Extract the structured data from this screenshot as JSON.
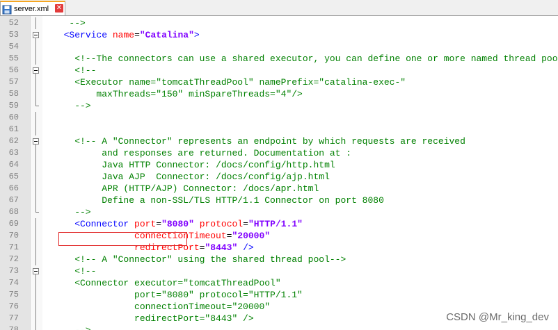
{
  "tab": {
    "label": "server.xml",
    "file_icon": "save-disk-icon",
    "close_icon": "close-icon"
  },
  "lines": [
    {
      "n": "52",
      "fold": "line",
      "segs": [
        {
          "t": "   -->",
          "c": "comment"
        }
      ]
    },
    {
      "n": "53",
      "fold": "open",
      "segs": [
        {
          "t": "  ",
          "c": "plain"
        },
        {
          "t": "<Service",
          "c": "tag"
        },
        {
          "t": " ",
          "c": "plain"
        },
        {
          "t": "name",
          "c": "attr"
        },
        {
          "t": "=",
          "c": "eq"
        },
        {
          "t": "\"Catalina\"",
          "c": "val"
        },
        {
          "t": ">",
          "c": "tag"
        }
      ]
    },
    {
      "n": "54",
      "fold": "line",
      "segs": []
    },
    {
      "n": "55",
      "fold": "line",
      "segs": [
        {
          "t": "    <!--The connectors can use a shared executor, you can define one or more named thread pools",
          "c": "comment"
        }
      ]
    },
    {
      "n": "56",
      "fold": "open",
      "segs": [
        {
          "t": "    <!--",
          "c": "comment"
        }
      ]
    },
    {
      "n": "57",
      "fold": "line",
      "segs": [
        {
          "t": "    <Executor name=\"tomcatThreadPool\" namePrefix=\"catalina-exec-\"",
          "c": "comment"
        }
      ]
    },
    {
      "n": "58",
      "fold": "line",
      "segs": [
        {
          "t": "        maxThreads=\"150\" minSpareThreads=\"4\"/>",
          "c": "comment"
        }
      ]
    },
    {
      "n": "59",
      "fold": "end",
      "segs": [
        {
          "t": "    -->",
          "c": "comment"
        }
      ]
    },
    {
      "n": "60",
      "fold": "line",
      "segs": []
    },
    {
      "n": "61",
      "fold": "line",
      "segs": []
    },
    {
      "n": "62",
      "fold": "open",
      "segs": [
        {
          "t": "    <!-- A \"Connector\" represents an endpoint by which requests are received",
          "c": "comment"
        }
      ]
    },
    {
      "n": "63",
      "fold": "line",
      "segs": [
        {
          "t": "         and responses are returned. Documentation at :",
          "c": "comment"
        }
      ]
    },
    {
      "n": "64",
      "fold": "line",
      "segs": [
        {
          "t": "         Java HTTP Connector: /docs/config/http.html",
          "c": "comment"
        }
      ]
    },
    {
      "n": "65",
      "fold": "line",
      "segs": [
        {
          "t": "         Java AJP  Connector: /docs/config/ajp.html",
          "c": "comment"
        }
      ]
    },
    {
      "n": "66",
      "fold": "line",
      "segs": [
        {
          "t": "         APR (HTTP/AJP) Connector: /docs/apr.html",
          "c": "comment"
        }
      ]
    },
    {
      "n": "67",
      "fold": "line",
      "segs": [
        {
          "t": "         Define a non-SSL/TLS HTTP/1.1 Connector on port 8080",
          "c": "comment"
        }
      ]
    },
    {
      "n": "68",
      "fold": "end",
      "segs": [
        {
          "t": "    -->",
          "c": "comment"
        }
      ]
    },
    {
      "n": "69",
      "fold": "line",
      "segs": [
        {
          "t": "    ",
          "c": "plain"
        },
        {
          "t": "<Connector",
          "c": "tag"
        },
        {
          "t": " ",
          "c": "plain"
        },
        {
          "t": "port",
          "c": "attr"
        },
        {
          "t": "=",
          "c": "eq"
        },
        {
          "t": "\"8080\"",
          "c": "val"
        },
        {
          "t": " ",
          "c": "plain"
        },
        {
          "t": "protocol",
          "c": "attr"
        },
        {
          "t": "=",
          "c": "eq"
        },
        {
          "t": "\"HTTP/1.1\"",
          "c": "val"
        }
      ]
    },
    {
      "n": "70",
      "fold": "line",
      "segs": [
        {
          "t": "               ",
          "c": "plain"
        },
        {
          "t": "connectionTimeout",
          "c": "attr"
        },
        {
          "t": "=",
          "c": "eq"
        },
        {
          "t": "\"20000\"",
          "c": "val"
        }
      ]
    },
    {
      "n": "71",
      "fold": "line",
      "segs": [
        {
          "t": "               ",
          "c": "plain"
        },
        {
          "t": "redirectPort",
          "c": "attr"
        },
        {
          "t": "=",
          "c": "eq"
        },
        {
          "t": "\"8443\"",
          "c": "val"
        },
        {
          "t": " />",
          "c": "tag"
        }
      ]
    },
    {
      "n": "72",
      "fold": "line",
      "segs": [
        {
          "t": "    <!-- A \"Connector\" using the shared thread pool-->",
          "c": "comment"
        }
      ]
    },
    {
      "n": "73",
      "fold": "open",
      "segs": [
        {
          "t": "    <!--",
          "c": "comment"
        }
      ]
    },
    {
      "n": "74",
      "fold": "line",
      "segs": [
        {
          "t": "    <Connector executor=\"tomcatThreadPool\"",
          "c": "comment"
        }
      ]
    },
    {
      "n": "75",
      "fold": "line",
      "segs": [
        {
          "t": "               port=\"8080\" protocol=\"HTTP/1.1\"",
          "c": "comment"
        }
      ]
    },
    {
      "n": "76",
      "fold": "line",
      "segs": [
        {
          "t": "               connectionTimeout=\"20000\"",
          "c": "comment"
        }
      ]
    },
    {
      "n": "77",
      "fold": "line",
      "segs": [
        {
          "t": "               redirectPort=\"8443\" />",
          "c": "comment"
        }
      ]
    },
    {
      "n": "78",
      "fold": "line",
      "segs": [
        {
          "t": "    -->",
          "c": "comment"
        }
      ]
    }
  ],
  "watermark": "CSDN @Mr_king_dev",
  "colors": {
    "comment": "#008000",
    "tag": "#0000ff",
    "attr": "#ff0000",
    "value": "#8000ff",
    "highlight_box": "#e02020"
  }
}
